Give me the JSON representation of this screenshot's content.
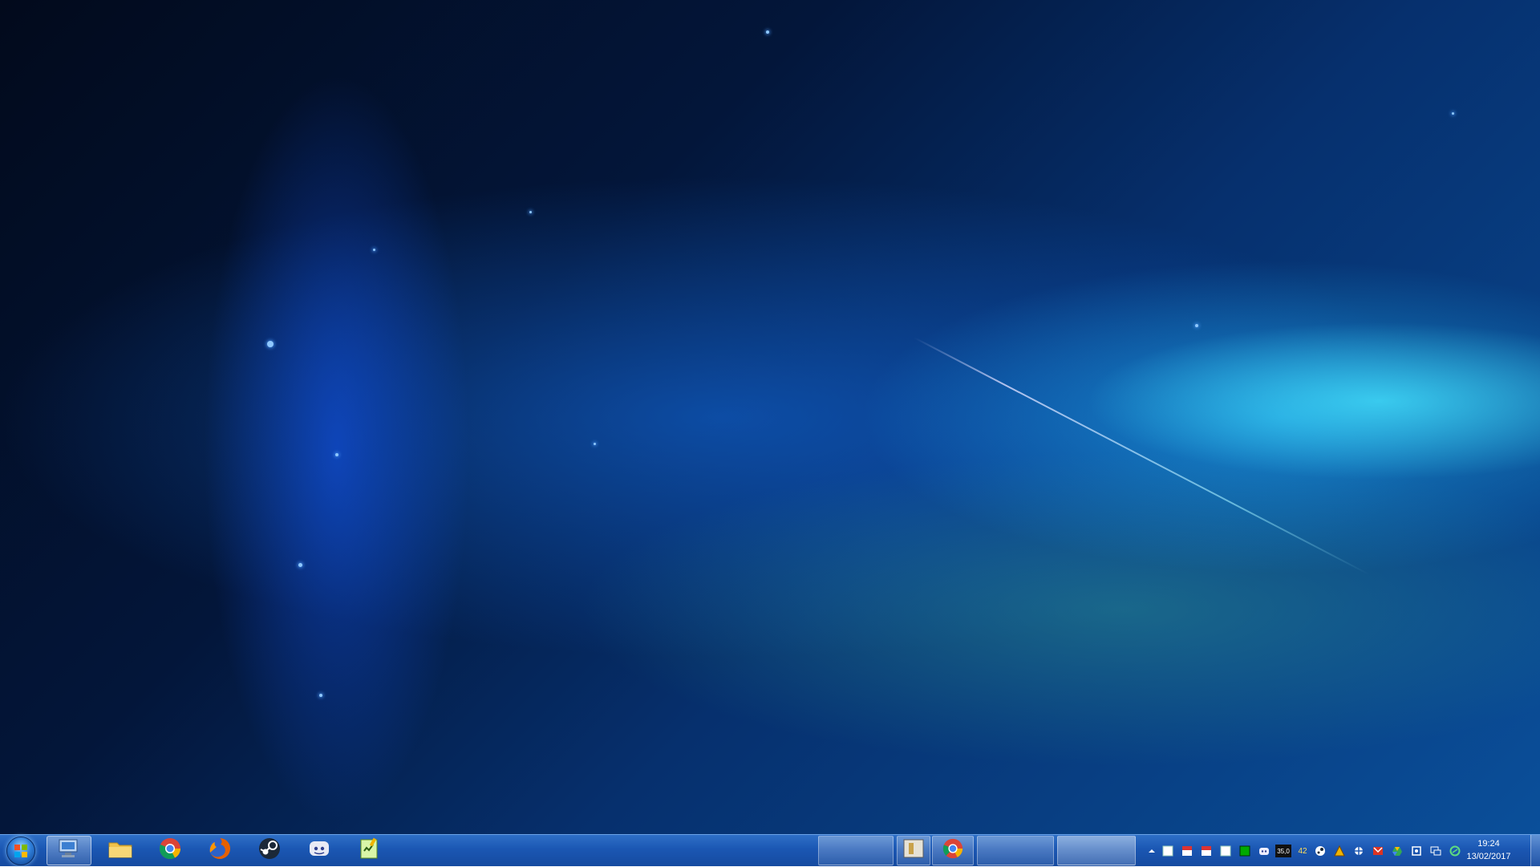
{
  "desktop": {
    "wallpaper": "blue-nebula-wallpaper"
  },
  "taskbar": {
    "start_icon": "windows-orb-icon",
    "pinned": [
      {
        "icon": "network-computer-icon",
        "active": true
      },
      {
        "icon": "folder-explorer-icon",
        "active": false
      },
      {
        "icon": "chrome-icon",
        "active": false
      },
      {
        "icon": "firefox-icon",
        "active": false
      },
      {
        "icon": "steam-icon",
        "active": false
      },
      {
        "icon": "discord-icon",
        "active": false
      },
      {
        "icon": "notepad-edit-icon",
        "active": false
      }
    ],
    "windows": [
      {
        "icon": "blank-window-icon"
      },
      {
        "icon": "folder-window-icon"
      },
      {
        "icon": "chrome-window-icon"
      },
      {
        "icon": "blank-window-icon"
      },
      {
        "icon": "blank-window-icon"
      }
    ]
  },
  "tray": {
    "overflow_icon": "chevron-up-icon",
    "icons": [
      "white-square-icon",
      "red-flag-icon",
      "red-flag-icon",
      "white-square-icon",
      "green-square-icon",
      "discord-tray-icon",
      "cpu-temp-icon",
      "temp-reading-icon",
      "steam-tray-icon",
      "warning-icon",
      "bug-icon",
      "mail-icon",
      "drive-icon",
      "settings-icon",
      "network-icon",
      "shield-icon"
    ],
    "cpu_label": "35,0",
    "temp_label": "42"
  },
  "clock": {
    "time": "19:24",
    "date": "13/02/2017"
  },
  "colors": {
    "taskbar": "#1b57b3",
    "accent": "#2f7ed8"
  }
}
